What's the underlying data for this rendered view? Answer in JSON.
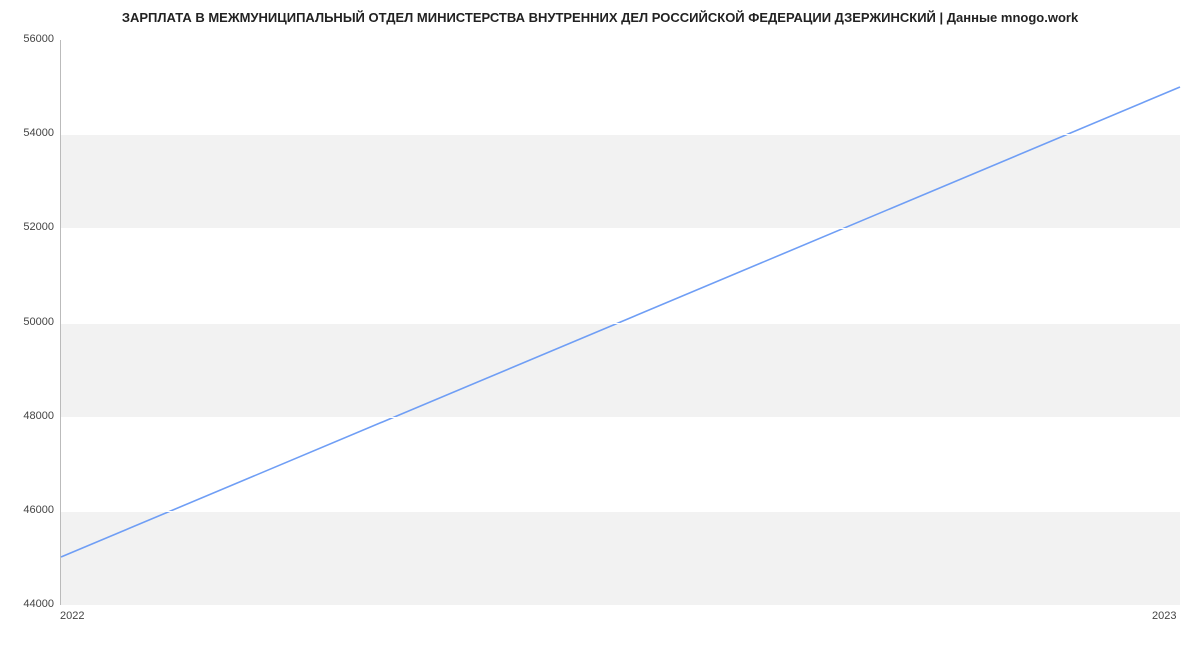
{
  "chart_data": {
    "type": "line",
    "title": "ЗАРПЛАТА В МЕЖМУНИЦИПАЛЬНЫЙ ОТДЕЛ МИНИСТЕРСТВА ВНУТРЕННИХ ДЕЛ РОССИЙСКОЙ ФЕДЕРАЦИИ ДЗЕРЖИНСКИЙ | Данные mnogo.work",
    "xlabel": "",
    "ylabel": "",
    "x": [
      2022,
      2023
    ],
    "values": [
      45000,
      55000
    ],
    "y_ticks": [
      44000,
      46000,
      48000,
      50000,
      52000,
      54000,
      56000
    ],
    "x_ticks": [
      2022,
      2023
    ],
    "ylim": [
      44000,
      56000
    ],
    "xlim": [
      2022,
      2023
    ],
    "line_color": "#6f9ef5",
    "band_color": "#f2f2f2"
  }
}
